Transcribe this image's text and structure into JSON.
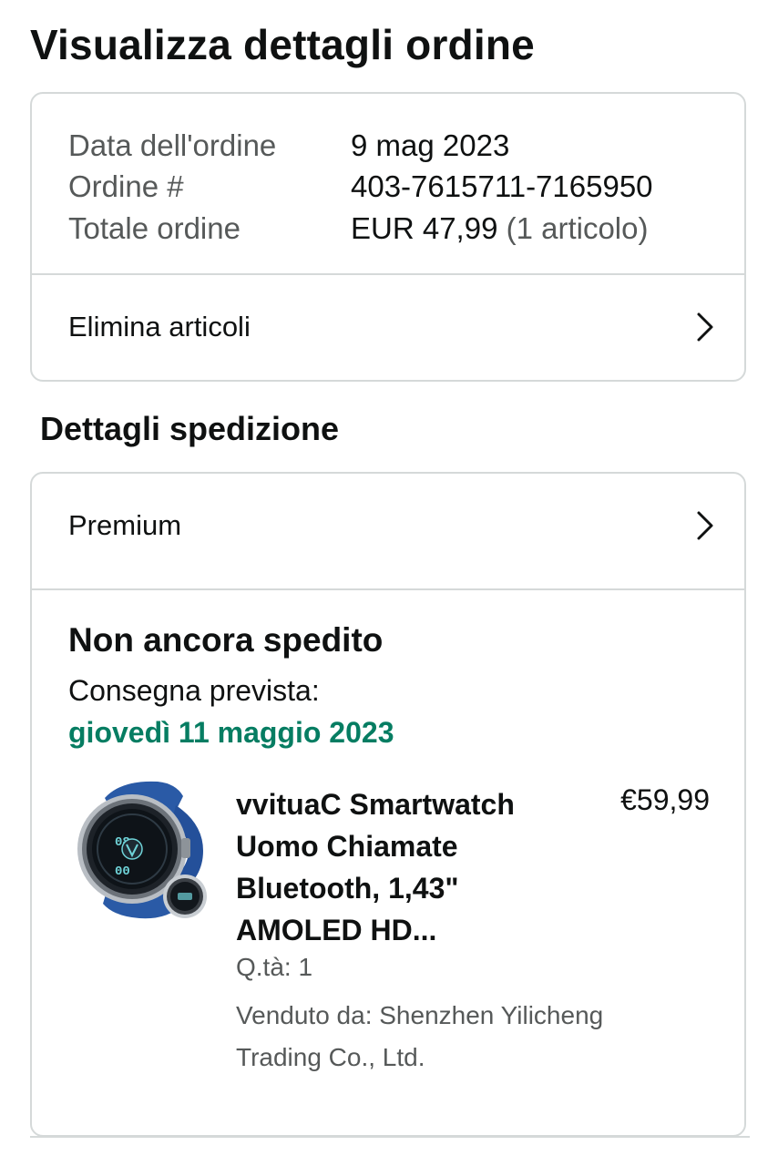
{
  "page_title": "Visualizza dettagli ordine",
  "order_summary": {
    "rows": [
      {
        "label": "Data dell'ordine",
        "value": "9 mag 2023",
        "extra": ""
      },
      {
        "label": "Ordine #",
        "value": "403-7615711-7165950",
        "extra": ""
      },
      {
        "label": "Totale ordine",
        "value": "EUR 47,99",
        "extra": " (1 articolo)"
      }
    ],
    "action_label": "Elimina articoli",
    "action_icon": "chevron-right-icon"
  },
  "shipping": {
    "section_title": "Dettagli spedizione",
    "method_label": "Premium",
    "method_icon": "chevron-right-icon",
    "status": "Non ancora spedito",
    "delivery_label": "Consegna prevista:",
    "delivery_date": "giovedì 11 maggio 2023",
    "delivery_date_color": "#067d62",
    "item": {
      "image_icon": "smartwatch-product-image",
      "title": "vvituaC Smartwatch Uomo Chiamate Bluetooth, 1,43\" AMOLED HD...",
      "price": "€59,99",
      "quantity": "Q.tà: 1",
      "seller": "Venduto da: Shenzhen Yilicheng Trading Co., Ltd."
    }
  },
  "colors": {
    "text": "#0f1111",
    "secondary_text": "#565959",
    "border": "#d5d9d9",
    "watch_band": "#2a5aa6"
  }
}
